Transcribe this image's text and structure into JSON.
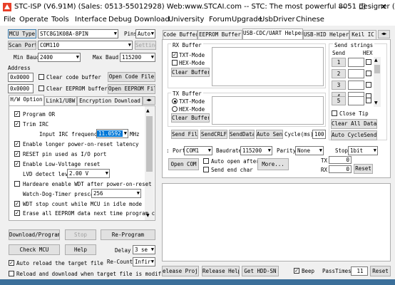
{
  "window": {
    "title": "STC-ISP (V6.91M) (Sales: 0513-55012928) Web:www.STCAI.com -- STC: The most powerful 8051 designer (...",
    "minimize": "—",
    "maximize": "☐",
    "close": "✕"
  },
  "menu": [
    "File",
    "Operate",
    "Tools",
    "Interface",
    "Debug",
    "Download",
    "University",
    "Forum",
    "Upgrade",
    "UsbDriver",
    "Chinese"
  ],
  "left": {
    "mcu_type_label": "MCU Type",
    "mcu_type_value": "STC8G1K08A-8PIN",
    "pins_label": "Pins",
    "pins_value": "Auto",
    "scan_port_label": "Scan Port",
    "scan_port_value": "COM110",
    "setting_label": "Setting",
    "min_baud_label": "Min Baud",
    "min_baud_value": "2400",
    "max_baud_label": "Max Baud",
    "max_baud_value": "115200",
    "address_label": "Address",
    "addr1_value": "0x0000",
    "clear_code_label": "Clear code buffer",
    "open_code_label": "Open Code File",
    "addr2_value": "0x0000",
    "clear_eeprom_label": "Clear EEPROM buffer",
    "open_eeprom_label": "Open EEPROM File",
    "tabs": [
      "H/W Option",
      "Link1/U8W",
      "Encryption Download"
    ],
    "options": {
      "program_or": "Program OR",
      "trim_irc": "Trim IRC",
      "irc_freq_label": "Input IRC frequency",
      "irc_freq_value": "11.0592",
      "irc_unit": "MHz",
      "longer_power": "Enable longer power-on-reset latency",
      "reset_pin": "RESET pin used as I/O port",
      "low_voltage": "Enable Low-Voltage reset",
      "lvd_label": "LVD detect leve",
      "lvd_value": "2.00 V",
      "hw_wdt": "Hardeare enable WDT after power-on-reset",
      "wdt_prescale_label": "Watch-Dog-Timer prescal",
      "wdt_prescale_value": "256",
      "wdt_stop": "WDT stop count while MCU in idle mode",
      "erase_eeprom": "Erase all EEPROM data next time program c"
    },
    "download_btn": "Download/Program",
    "stop_btn": "Stop",
    "reprogram_btn": "Re-Program",
    "check_mcu_btn": "Check MCU",
    "help_btn": "Help",
    "delay_label": "Delay",
    "delay_value": "3 se",
    "auto_reload": "Auto reload the target file",
    "recount_label": "Re-Count",
    "recount_value": "Infir",
    "reload_download": "Reload and download when target file is modified"
  },
  "right": {
    "tabs": [
      "Code Buffer",
      "EEPROM Buffer",
      "USB-CDC/UART Helper",
      "USB-HID Helper",
      "Keil IC"
    ],
    "rx_buffer_label": "RX Buffer",
    "rx_txt_mode": "TXT-Mode",
    "rx_hex_mode": "HEX-Mode",
    "rx_clear": "Clear Buffer",
    "send_strings_label": "Send strings",
    "send_col": "Send",
    "hex_col": "HEX",
    "send_rows": [
      "1",
      "2",
      "3",
      "4",
      "5"
    ],
    "close_tip": "Close Tip",
    "clear_all_data": "Clear All Data",
    "auto_cycle_send": "Auto CycleSend",
    "tx_buffer_label": "TX Buffer",
    "tx_txt_mode": "TXT-Mode",
    "tx_hex_mode": "HEX-Mode",
    "tx_clear": "Clear Buffer",
    "send_file": "Send File",
    "send_crlf": "SendCRLF",
    "send_data": "SendData",
    "auto_send": "Auto Send",
    "cycle_label": "Cycle(ms)",
    "cycle_value": "100",
    "port_label": ": Port",
    "port_value": "COM1",
    "baud_label": "Baudrate",
    "baud_value": "115200",
    "parity_label": "Parity",
    "parity_value": "None",
    "stop_label": "Stop",
    "stop_value": "1bit",
    "open_com": "Open COM",
    "auto_open": "Auto open after progra",
    "send_end": "Send end char",
    "more": "More...",
    "tx_label": "TX",
    "tx_count": "0",
    "rx_label": "RX",
    "rx_count": "0",
    "reset": "Reset"
  },
  "bottom": {
    "release_project": "elease Projec",
    "release_help": "Release Help",
    "get_hdd_sn": "Get HDD-SN",
    "beep": "Beep",
    "pass_times_label": "PassTimes",
    "pass_times_value": "11",
    "reset": "Reset"
  }
}
